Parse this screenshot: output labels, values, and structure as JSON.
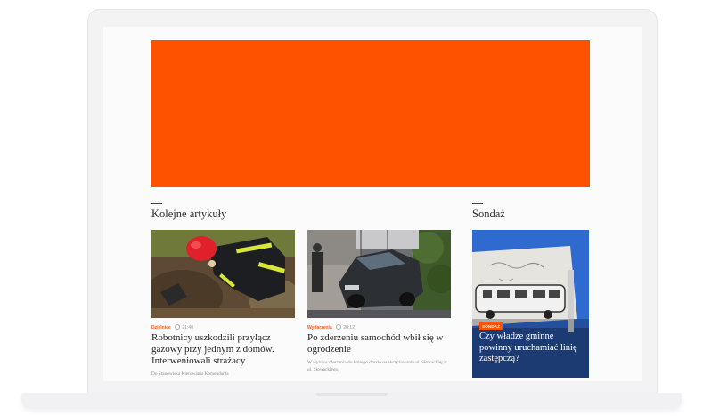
{
  "sections": {
    "articles_title": "Kolejne artykuły",
    "poll_title": "Sondaż"
  },
  "articles": [
    {
      "category": "Dzielnice",
      "time": "21:40",
      "headline": "Robotnicy uszkodzili przyłącz gazowy przy jednym z domów. Interweniowali strażacy",
      "excerpt": "Do Stanowiska Kierowania Komendanta"
    },
    {
      "category": "Wydarzenia",
      "time": "20:12",
      "headline": "Po zderzeniu samochód wbił się w ogrodzenie",
      "excerpt": "W wyniku zderzenia do którego doszło na skrzyżowaniu ul. Słowackiej z ul. Słowackiego,"
    }
  ],
  "poll": {
    "badge": "SONDAŻ",
    "question": "Czy władze gminne powinny uruchamiać linię zastępczą?"
  },
  "colors": {
    "accent": "#ff5200",
    "poll_bg": "#2f6ad1"
  }
}
